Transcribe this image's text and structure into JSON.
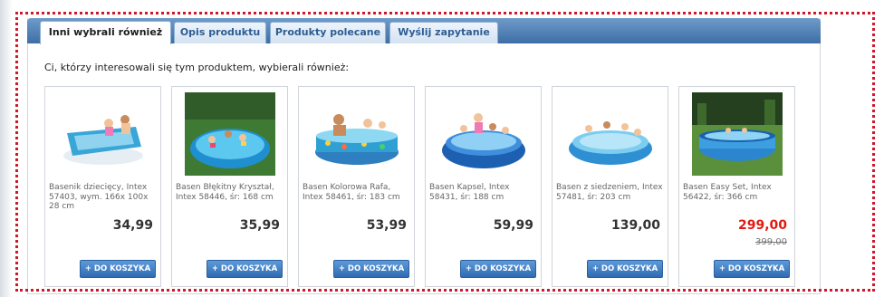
{
  "tabs": [
    {
      "label": "Inni wybrali również",
      "active": true
    },
    {
      "label": "Opis produktu",
      "active": false
    },
    {
      "label": "Produkty polecane",
      "active": false
    },
    {
      "label": "Wyślij zapytanie",
      "active": false
    }
  ],
  "intro_text": "Ci, którzy interesowali się tym produktem, wybierali również:",
  "products": [
    {
      "name": "Basenik dziecięcy, Intex 57403, wym. 166x 100x 28 cm",
      "price": "34,99",
      "old_price": "",
      "button": "+ DO KOSZYKA"
    },
    {
      "name": "Basen Błękitny Kryształ, Intex 58446, śr: 168 cm",
      "price": "35,99",
      "old_price": "",
      "button": "+ DO KOSZYKA"
    },
    {
      "name": "Basen Kolorowa Rafa, Intex 58461, śr: 183 cm",
      "price": "53,99",
      "old_price": "",
      "button": "+ DO KOSZYKA"
    },
    {
      "name": "Basen Kapsel, Intex 58431, śr: 188 cm",
      "price": "59,99",
      "old_price": "",
      "button": "+ DO KOSZYKA"
    },
    {
      "name": "Basen z siedzeniem, Intex 57481, śr: 203 cm",
      "price": "139,00",
      "old_price": "",
      "button": "+ DO KOSZYKA"
    },
    {
      "name": "Basen Easy Set, Intex 56422, śr: 366 cm",
      "price": "299,00",
      "old_price": "399,00",
      "button": "+ DO KOSZYKA"
    }
  ],
  "colors": {
    "tab_bar": "#3e6ea6",
    "sale_price": "#e11a12",
    "button": "#2f6bb2",
    "frame_dots": "#d0182a"
  }
}
